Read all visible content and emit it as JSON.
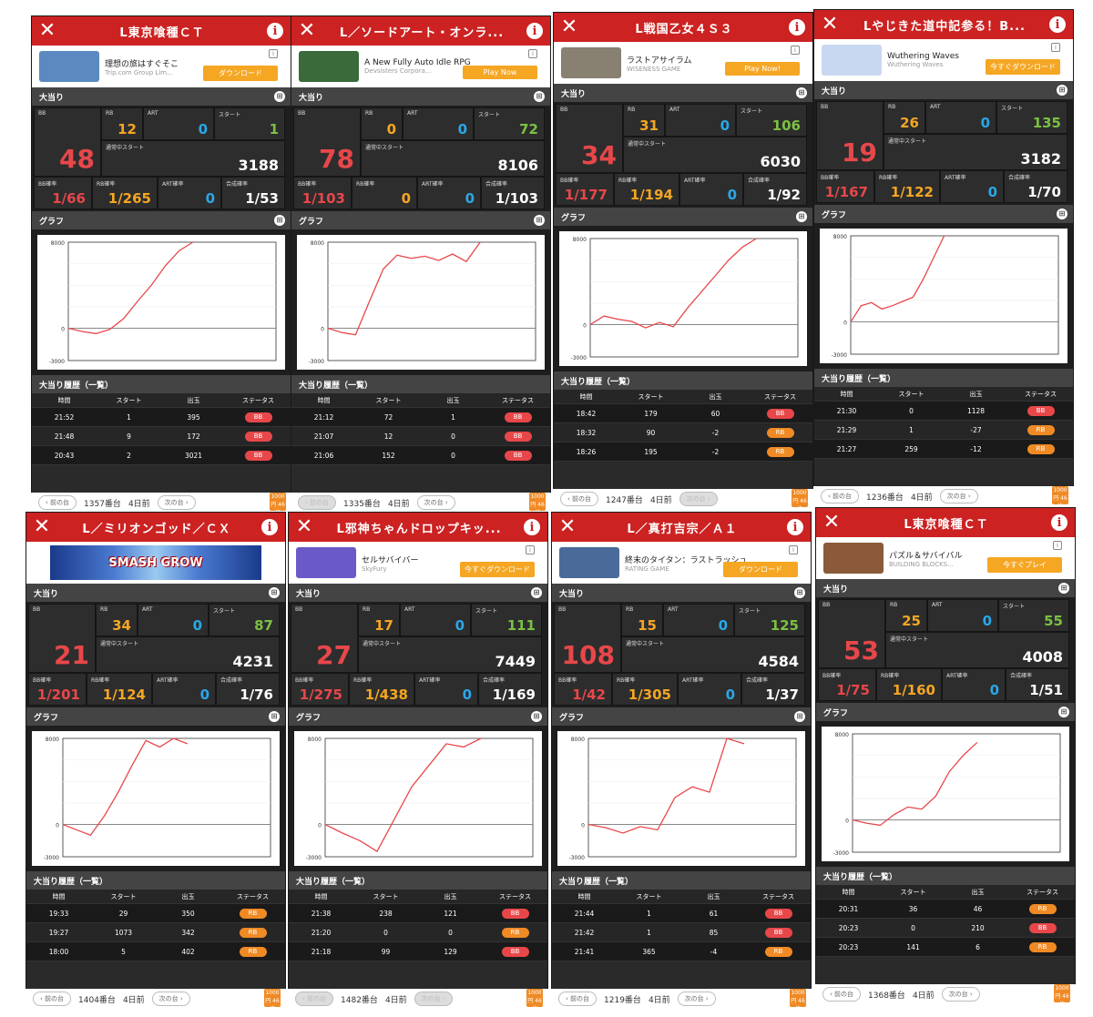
{
  "section_labels": {
    "hits": "大当り",
    "graph": "グラフ",
    "history": "大当り履歴（一覧）"
  },
  "stat_labels": {
    "bb": "BB",
    "rb": "RB",
    "art": "ART",
    "start": "スタート",
    "normal_start": "通常中スタート",
    "bb_rate": "BB確率",
    "rb_rate": "RB確率",
    "art_rate": "ART確率",
    "combined_rate": "合成確率"
  },
  "history_headers": [
    "時間",
    "スタート",
    "出玉",
    "ステータス"
  ],
  "nav": {
    "prev": "前の台",
    "next": "次の台"
  },
  "graph_axis": {
    "top": "8000",
    "zero": "0",
    "bottom": "-3000"
  },
  "badge_label": "1000円 46枚",
  "colors": {
    "header": "#cc2222",
    "bb": "#e8474a",
    "rb": "#f5a623",
    "art": "#2aa7e8",
    "start": "#7bc043"
  },
  "panels": [
    {
      "title": "L東京喰種ＣＴ",
      "ad": {
        "name": "理想の旅はすぐそこ",
        "sub": "Trip.com Group Lim...",
        "button": "ダウンロード",
        "thumb": "#5a8ac0"
      },
      "bb": "48",
      "rb": "12",
      "art": "0",
      "start": "1",
      "normal_start": "3188",
      "bb_rate": "1/66",
      "rb_rate": "1/265",
      "art_rate": "0",
      "combined_rate": "1/53",
      "graph": [
        [
          0,
          0
        ],
        [
          4,
          -300
        ],
        [
          8,
          -500
        ],
        [
          12,
          -100
        ],
        [
          16,
          900
        ],
        [
          20,
          2500
        ],
        [
          24,
          4000
        ],
        [
          28,
          5800
        ],
        [
          32,
          7200
        ],
        [
          36,
          8000
        ]
      ],
      "history": [
        [
          "21:52",
          "1",
          "395",
          "BB"
        ],
        [
          "21:48",
          "9",
          "172",
          "BB"
        ],
        [
          "20:43",
          "2",
          "3021",
          "BB"
        ]
      ],
      "machine": "1357番台",
      "ago": "4日前",
      "prev_disabled": false,
      "next_disabled": false
    },
    {
      "title": "L／ソードアート・オンラ...",
      "ad": {
        "name": "A New Fully Auto Idle RPG",
        "sub": "Devsisters Corpora...",
        "button": "Play Now",
        "thumb": "#3a6a3a"
      },
      "bb": "78",
      "rb": "0",
      "art": "0",
      "start": "72",
      "normal_start": "8106",
      "bb_rate": "1/103",
      "rb_rate": "0",
      "art_rate": "0",
      "combined_rate": "1/103",
      "graph": [
        [
          0,
          0
        ],
        [
          4,
          -400
        ],
        [
          8,
          -600
        ],
        [
          12,
          2500
        ],
        [
          16,
          5500
        ],
        [
          20,
          6800
        ],
        [
          24,
          6500
        ],
        [
          28,
          6700
        ],
        [
          32,
          6300
        ],
        [
          36,
          6900
        ],
        [
          40,
          6200
        ],
        [
          44,
          8000
        ]
      ],
      "history": [
        [
          "21:12",
          "72",
          "1",
          "BB"
        ],
        [
          "21:07",
          "12",
          "0",
          "BB"
        ],
        [
          "21:06",
          "152",
          "0",
          "BB"
        ]
      ],
      "machine": "1335番台",
      "ago": "4日前",
      "prev_disabled": true,
      "next_disabled": false
    },
    {
      "title": "L戦国乙女４Ｓ３",
      "ad": {
        "name": "ラストアサイラム",
        "sub": "WISENESS GAME",
        "button": "Play Now!",
        "thumb": "#888070"
      },
      "bb": "34",
      "rb": "31",
      "art": "0",
      "start": "106",
      "normal_start": "6030",
      "bb_rate": "1/177",
      "rb_rate": "1/194",
      "art_rate": "0",
      "combined_rate": "1/92",
      "graph": [
        [
          0,
          0
        ],
        [
          4,
          800
        ],
        [
          8,
          500
        ],
        [
          12,
          300
        ],
        [
          16,
          -300
        ],
        [
          20,
          200
        ],
        [
          24,
          -200
        ],
        [
          28,
          1500
        ],
        [
          32,
          3000
        ],
        [
          36,
          4500
        ],
        [
          40,
          6000
        ],
        [
          44,
          7200
        ],
        [
          48,
          8000
        ]
      ],
      "history": [
        [
          "18:42",
          "179",
          "60",
          "BB"
        ],
        [
          "18:32",
          "90",
          "-2",
          "RB"
        ],
        [
          "18:26",
          "195",
          "-2",
          "RB"
        ]
      ],
      "machine": "1247番台",
      "ago": "4日前",
      "prev_disabled": false,
      "next_disabled": true
    },
    {
      "title": "Lやじきた道中記参る！B...",
      "ad": {
        "name": "Wuthering Waves",
        "sub": "Wuthering Waves",
        "button": "今すぐダウンロード",
        "thumb": "#c8d8f0"
      },
      "bb": "19",
      "rb": "26",
      "art": "0",
      "start": "135",
      "normal_start": "3182",
      "bb_rate": "1/167",
      "rb_rate": "1/122",
      "art_rate": "0",
      "combined_rate": "1/70",
      "graph": [
        [
          0,
          0
        ],
        [
          3,
          1500
        ],
        [
          6,
          1800
        ],
        [
          9,
          1200
        ],
        [
          12,
          1500
        ],
        [
          15,
          1900
        ],
        [
          18,
          2300
        ],
        [
          21,
          4000
        ],
        [
          24,
          6000
        ],
        [
          27,
          8000
        ]
      ],
      "history": [
        [
          "21:30",
          "0",
          "1128",
          "BB"
        ],
        [
          "21:29",
          "1",
          "-27",
          "RB"
        ],
        [
          "21:27",
          "259",
          "-12",
          "RB"
        ]
      ],
      "machine": "1236番台",
      "ago": "4日前",
      "prev_disabled": false,
      "next_disabled": false
    },
    {
      "title": "L／ミリオンゴッド／ＣＸ",
      "ad": {
        "name": "SMASH GROW",
        "banner": true
      },
      "bb": "21",
      "rb": "34",
      "art": "0",
      "start": "87",
      "normal_start": "4231",
      "bb_rate": "1/201",
      "rb_rate": "1/124",
      "art_rate": "0",
      "combined_rate": "1/76",
      "graph": [
        [
          0,
          0
        ],
        [
          4,
          -500
        ],
        [
          8,
          -1000
        ],
        [
          12,
          800
        ],
        [
          16,
          3000
        ],
        [
          20,
          5500
        ],
        [
          24,
          7800
        ],
        [
          28,
          7200
        ],
        [
          32,
          8000
        ],
        [
          36,
          7500
        ]
      ],
      "history": [
        [
          "19:33",
          "29",
          "350",
          "RB"
        ],
        [
          "19:27",
          "1073",
          "342",
          "RB"
        ],
        [
          "18:00",
          "5",
          "402",
          "RB"
        ]
      ],
      "machine": "1404番台",
      "ago": "4日前",
      "prev_disabled": false,
      "next_disabled": false
    },
    {
      "title": "L邪神ちゃんドロップキッ...",
      "ad": {
        "name": "セルサバイバー",
        "sub": "SkyFury",
        "button": "今すぐダウンロード",
        "thumb": "#6a5ac8"
      },
      "bb": "27",
      "rb": "17",
      "art": "0",
      "start": "111",
      "normal_start": "7449",
      "bb_rate": "1/275",
      "rb_rate": "1/438",
      "art_rate": "0",
      "combined_rate": "1/169",
      "graph": [
        [
          0,
          0
        ],
        [
          5,
          -800
        ],
        [
          10,
          -1500
        ],
        [
          15,
          -2500
        ],
        [
          20,
          500
        ],
        [
          25,
          3500
        ],
        [
          30,
          5500
        ],
        [
          35,
          7500
        ],
        [
          40,
          7200
        ],
        [
          45,
          8000
        ]
      ],
      "history": [
        [
          "21:38",
          "238",
          "121",
          "BB"
        ],
        [
          "21:20",
          "0",
          "0",
          "RB"
        ],
        [
          "21:18",
          "99",
          "129",
          "BB"
        ]
      ],
      "machine": "1482番台",
      "ago": "4日前",
      "prev_disabled": true,
      "next_disabled": true
    },
    {
      "title": "L／真打吉宗／Ａ１",
      "ad": {
        "name": "終末のタイタン：ラストラッシュ",
        "sub": "RATING GAME",
        "button": "ダウンロード",
        "thumb": "#4a6a9a"
      },
      "bb": "108",
      "rb": "15",
      "art": "0",
      "start": "125",
      "normal_start": "4584",
      "bb_rate": "1/42",
      "rb_rate": "1/305",
      "art_rate": "0",
      "combined_rate": "1/37",
      "graph": [
        [
          0,
          0
        ],
        [
          5,
          -300
        ],
        [
          10,
          -800
        ],
        [
          15,
          -200
        ],
        [
          20,
          -500
        ],
        [
          25,
          2500
        ],
        [
          30,
          3500
        ],
        [
          35,
          3000
        ],
        [
          40,
          8000
        ],
        [
          45,
          7500
        ]
      ],
      "history": [
        [
          "21:44",
          "1",
          "61",
          "BB"
        ],
        [
          "21:42",
          "1",
          "85",
          "BB"
        ],
        [
          "21:41",
          "365",
          "-4",
          "RB"
        ]
      ],
      "machine": "1219番台",
      "ago": "4日前",
      "prev_disabled": false,
      "next_disabled": false
    },
    {
      "title": "L東京喰種ＣＴ",
      "ad": {
        "name": "パズル＆サバイバル",
        "sub": "BUILDING BLOCKS...",
        "button": "今すぐプレイ",
        "thumb": "#8a5a3a"
      },
      "bb": "53",
      "rb": "25",
      "art": "0",
      "start": "55",
      "normal_start": "4008",
      "bb_rate": "1/75",
      "rb_rate": "1/160",
      "art_rate": "0",
      "combined_rate": "1/51",
      "graph": [
        [
          0,
          0
        ],
        [
          4,
          -300
        ],
        [
          8,
          -500
        ],
        [
          12,
          500
        ],
        [
          16,
          1200
        ],
        [
          20,
          1000
        ],
        [
          24,
          2200
        ],
        [
          28,
          4500
        ],
        [
          32,
          6000
        ],
        [
          36,
          7200
        ]
      ],
      "history": [
        [
          "20:31",
          "36",
          "46",
          "RB"
        ],
        [
          "20:23",
          "0",
          "210",
          "BB"
        ],
        [
          "20:23",
          "141",
          "6",
          "RB"
        ]
      ],
      "machine": "1368番台",
      "ago": "4日前",
      "prev_disabled": false,
      "next_disabled": false
    }
  ]
}
